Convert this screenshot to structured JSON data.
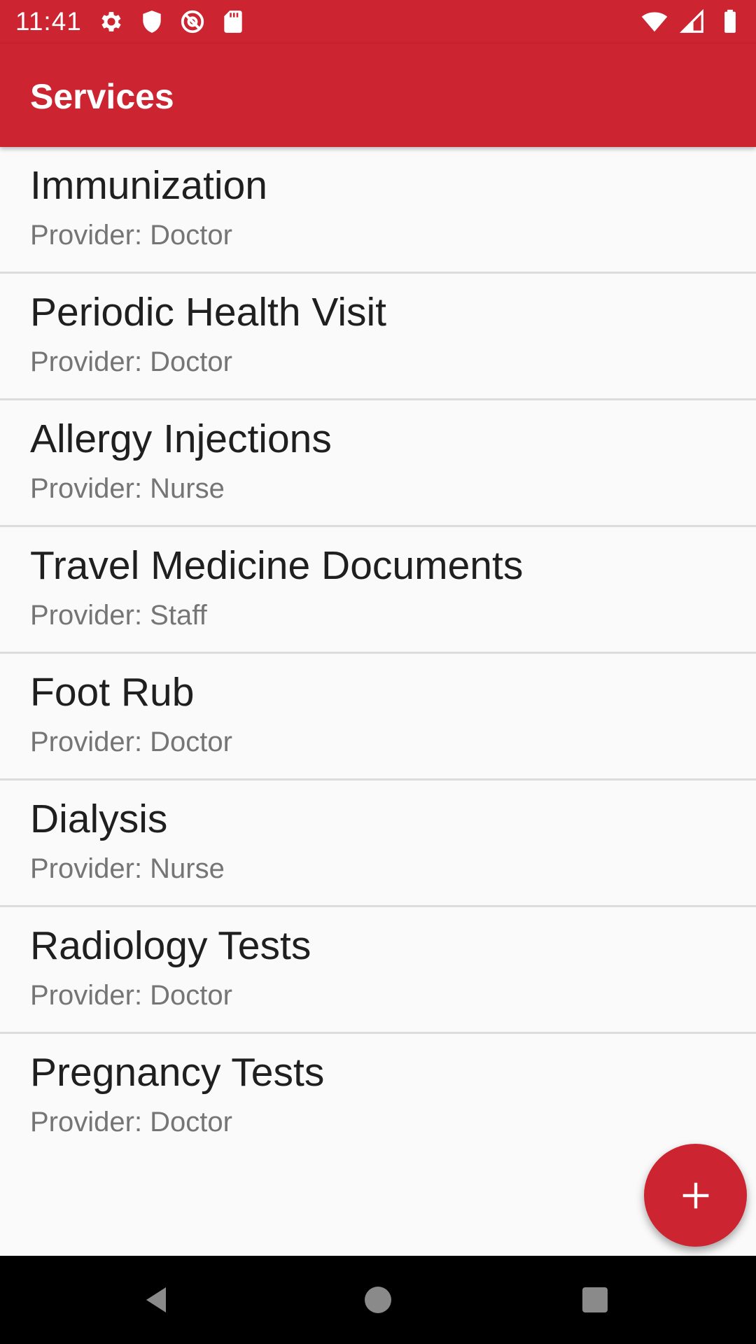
{
  "status_bar": {
    "time": "11:41",
    "left_icons": [
      "settings-gear-icon",
      "shield-icon",
      "at-sign-icon",
      "sd-card-icon"
    ],
    "right_icons": [
      "wifi-icon",
      "cell-signal-icon",
      "battery-icon"
    ]
  },
  "app_bar": {
    "title": "Services",
    "color": "#cc2430"
  },
  "services": [
    {
      "name": "Immunization",
      "provider": "Provider: Doctor"
    },
    {
      "name": "Periodic Health Visit",
      "provider": "Provider: Doctor"
    },
    {
      "name": "Allergy Injections",
      "provider": "Provider: Nurse"
    },
    {
      "name": "Travel Medicine Documents",
      "provider": "Provider: Staff"
    },
    {
      "name": "Foot Rub",
      "provider": "Provider: Doctor"
    },
    {
      "name": "Dialysis",
      "provider": "Provider: Nurse"
    },
    {
      "name": "Radiology Tests",
      "provider": "Provider: Doctor"
    },
    {
      "name": "Pregnancy Tests",
      "provider": "Provider: Doctor"
    }
  ],
  "fab": {
    "icon": "plus-icon"
  },
  "nav_bar": {
    "buttons": [
      "back-triangle-icon",
      "home-circle-icon",
      "recents-square-icon"
    ]
  }
}
